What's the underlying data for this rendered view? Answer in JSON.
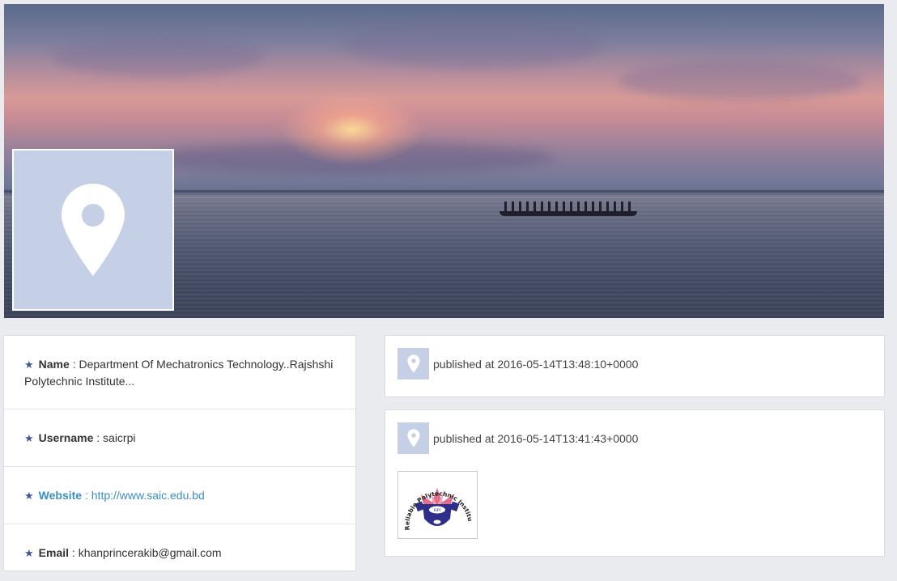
{
  "cover": {
    "icon": "map-pin-icon"
  },
  "profile": {
    "fields": [
      {
        "label": "Name",
        "separator": " : ",
        "value": "Department Of Mechatronics Technology..Rajshshi Polytechnic Institute..."
      },
      {
        "label": "Username",
        "separator": " : ",
        "value": "saicrpi"
      },
      {
        "label": "Website",
        "separator": " : ",
        "value": "http://www.saic.edu.bd"
      },
      {
        "label": "Email",
        "separator": " : ",
        "value": "khanprincerakib@gmail.com"
      }
    ],
    "star_icon": "star-icon",
    "link_color": "#3b8ec4",
    "star_color": "#3b5998"
  },
  "posts": [
    {
      "text": "published at 2016-05-14T13:48:10+0000",
      "icon": "map-pin-icon"
    },
    {
      "text": "published at 2016-05-14T13:41:43+0000",
      "icon": "map-pin-icon",
      "image": {
        "logo_text": "Reliable Polytechnic Institute",
        "badge": "RPI"
      }
    }
  ],
  "colors": {
    "page_bg": "#e9ebee",
    "placeholder_bg": "#c5cfe6"
  }
}
